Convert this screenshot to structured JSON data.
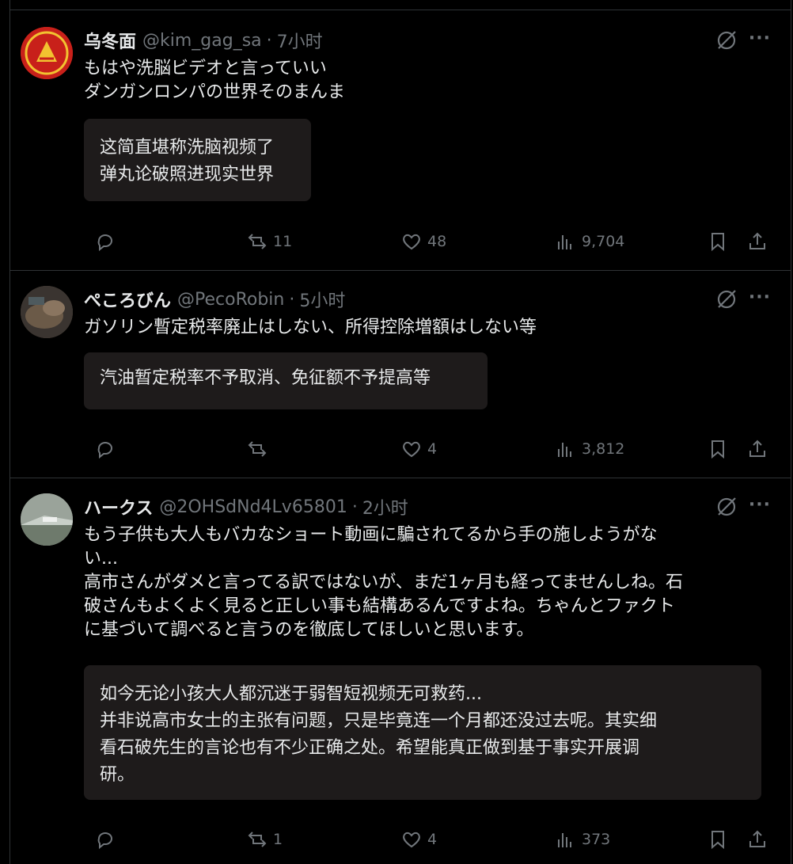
{
  "tweets": [
    {
      "name": "乌冬面",
      "handle": "@kim_gag_sa",
      "time": "7小时",
      "text": "もはや洗脳ビデオと言っていい\nダンガンロンパの世界そのまんま",
      "translation": "这简直堪称洗脑视频了\n弹丸论破照进现实世界",
      "replies": "",
      "reposts": "11",
      "likes": "48",
      "views": "9,704",
      "avatar_color": "#d4281c"
    },
    {
      "name": "ぺころびん",
      "handle": "@PecoRobin",
      "time": "5小时",
      "text": "ガソリン暫定税率廃止はしない、所得控除増額はしない等",
      "translation": "汽油暂定税率不予取消、免征额不予提高等",
      "replies": "",
      "reposts": "",
      "likes": "4",
      "views": "3,812",
      "avatar_color": "#5a4a3a"
    },
    {
      "name": "ハークス",
      "handle": "@2OHSdNd4Lv65801",
      "time": "2小时",
      "text": "もう子供も大人もバカなショート動画に騙されてるから手の施しようがな\nい...\n高市さんがダメと言ってる訳ではないが、まだ1ヶ月も経ってませんしね。石\n破さんもよくよく見ると正しい事も結構あるんですよね。ちゃんとファクト\nに基づいて調べると言うのを徹底してほしいと思います。",
      "translation": "如今无论小孩大人都沉迷于弱智短视频无可救药...\n并非说高市女士的主张有问题，只是毕竟连一个月都还没过去呢。其实细\n看石破先生的言论也有不少正确之处。希望能真正做到基于事实开展调\n研。",
      "replies": "",
      "reposts": "1",
      "likes": "4",
      "views": "373",
      "avatar_color": "#8a9486"
    }
  ],
  "colors": {
    "background": "#000000",
    "text": "#e7e9ea",
    "muted": "#71767b",
    "border": "#2f3336",
    "translation_bg": "#1e1b1b"
  },
  "icons": {
    "reply": "reply-icon",
    "repost": "repost-icon",
    "like": "heart-icon",
    "views": "views-icon",
    "bookmark": "bookmark-icon",
    "share": "share-icon",
    "grok": "grok-icon",
    "more": "more-icon"
  }
}
